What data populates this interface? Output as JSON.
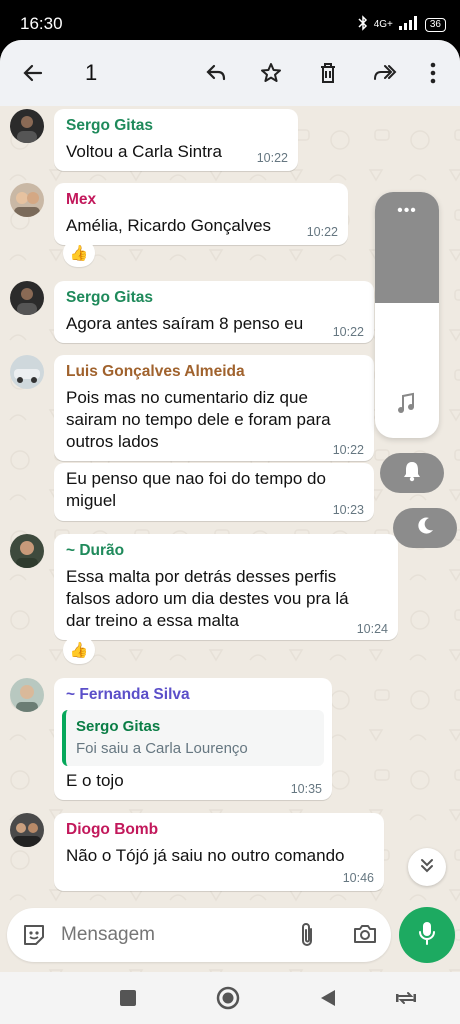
{
  "status_bar": {
    "time": "16:30",
    "network": "4G+",
    "battery": "36"
  },
  "topbar": {
    "selected_count": "1"
  },
  "colors": {
    "accent_green": "#1daa61",
    "bubble_bg": "#ffffff",
    "chat_bg": "#efeae2"
  },
  "messages": [
    {
      "sender": "Sergo Gitas",
      "sender_color": "#1f8a5b",
      "text": "Voltou a Carla Sintra",
      "time": "10:22"
    },
    {
      "sender": "Mex",
      "sender_color": "#c2185b",
      "text": "Amélia, Ricardo Gonçalves",
      "time": "10:22",
      "reaction": "👍"
    },
    {
      "sender": "Sergo Gitas",
      "sender_color": "#1f8a5b",
      "text": "Agora antes saíram 8 penso eu",
      "time": "10:22"
    },
    {
      "sender": "Luis Gonçalves Almeida",
      "sender_color": "#a0622d",
      "text": "Pois mas no cumentario diz que\nsairam no tempo dele e foram para\noutros lados",
      "time": "10:22"
    },
    {
      "sender": "",
      "text": "Eu penso que nao foi do tempo do\nmiguel",
      "time": "10:23"
    },
    {
      "sender": "~ Durão",
      "sender_color": "#1f8a5b",
      "text": "Essa malta por detrás desses perfis\nfalsos adoro um dia destes vou pra lá\ndar treino a essa malta",
      "time": "10:24",
      "reaction": "👍"
    },
    {
      "sender": "~ Fernanda Silva",
      "sender_color": "#5b4fc9",
      "quote": {
        "name": "Sergo Gitas",
        "text": "Foi saiu a Carla Lourenço"
      },
      "text": "E o tojo",
      "time": "10:35"
    },
    {
      "sender": "Diogo Bomb",
      "sender_color": "#c2185b",
      "text": "Não o Tójó já saiu no outro comando",
      "time": "10:46"
    }
  ],
  "volume": {
    "dots": "•••",
    "level": 0.45
  },
  "composer": {
    "placeholder": "Mensagem"
  }
}
